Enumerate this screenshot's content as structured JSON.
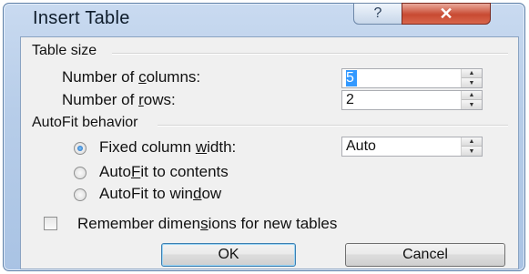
{
  "window": {
    "title": "Insert Table",
    "help_glyph": "?",
    "close_glyph": "✕"
  },
  "table_size": {
    "group_label": "Table size",
    "columns": {
      "label_pre": "Number of ",
      "label_key": "c",
      "label_post": "olumns:",
      "value": "5"
    },
    "rows": {
      "label_pre": "Number of ",
      "label_key": "r",
      "label_post": "ows:",
      "value": "2"
    }
  },
  "autofit": {
    "group_label": "AutoFit behavior",
    "options": [
      {
        "pre": "Fixed column ",
        "key": "w",
        "post": "idth:",
        "selected": true
      },
      {
        "pre": "Auto",
        "key": "F",
        "post": "it to contents",
        "selected": false
      },
      {
        "pre": "AutoFit to win",
        "key": "d",
        "post": "ow",
        "selected": false
      }
    ],
    "fixed_width_value": "Auto"
  },
  "remember": {
    "pre": "Remember dimen",
    "key": "s",
    "post": "ions for new tables",
    "checked": false
  },
  "buttons": {
    "ok": "OK",
    "cancel": "Cancel"
  },
  "icons": {
    "spin_up": "▲",
    "spin_down": "▼"
  }
}
